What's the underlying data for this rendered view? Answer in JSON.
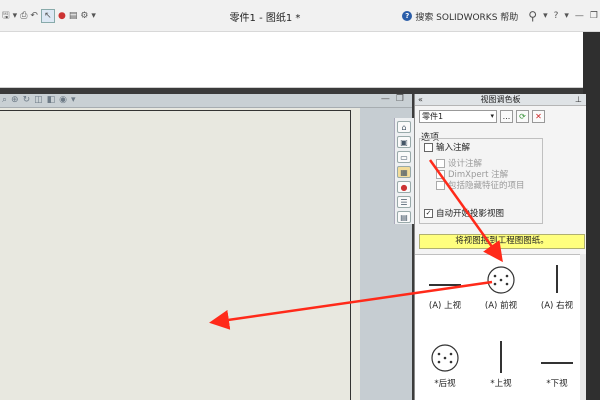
{
  "titlebar": {
    "title": "零件1 - 图纸1 *",
    "search_label": "搜索 SOLIDWORKS 帮助",
    "help_mark": "?",
    "minimize": "—",
    "restore": "❐"
  },
  "drawing_window": {
    "min": "—",
    "restore": "❐"
  },
  "palette": {
    "title": "视图调色板",
    "part_selector": "零件1",
    "browse_label": "...",
    "options_title": "选项",
    "options": [
      {
        "label": "输入注解",
        "checked": false,
        "enabled": true
      },
      {
        "label": "设计注解",
        "checked": false,
        "enabled": false
      },
      {
        "label": "DimXpert 注解",
        "checked": false,
        "enabled": false
      },
      {
        "label": "包括隐藏特征的项目",
        "checked": false,
        "enabled": false
      },
      {
        "label": "自动开始投影视图",
        "checked": true,
        "enabled": true
      }
    ],
    "hint": "将视图拖到工程图图纸。",
    "views": [
      {
        "label": "(A) 上视",
        "icon": "top-view-icon"
      },
      {
        "label": "(A) 前视",
        "icon": "front-view-icon"
      },
      {
        "label": "(A) 右视",
        "icon": "right-view-icon"
      },
      {
        "label": "*后视",
        "icon": "back-view-icon"
      },
      {
        "label": "*上视",
        "icon": "bottom-view-icon"
      },
      {
        "label": "*下视",
        "icon": "lower-view-icon"
      }
    ]
  },
  "colors": {
    "arrow": "#ff2a1a",
    "hint_bg": "#ffff7e",
    "sheet_bg": "#e8e8e0"
  }
}
